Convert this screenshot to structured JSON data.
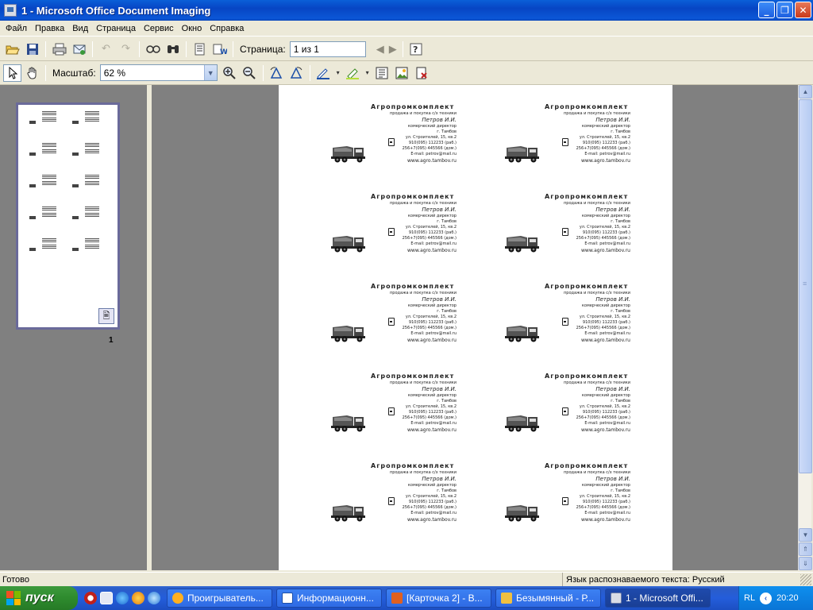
{
  "window": {
    "title": "1 - Microsoft Office Document Imaging",
    "minimize": "_",
    "maximize": "❐",
    "close": "✕"
  },
  "menu": [
    "Файл",
    "Правка",
    "Вид",
    "Страница",
    "Сервис",
    "Окно",
    "Справка"
  ],
  "toolbar": {
    "page_label": "Страница:",
    "page_value": "1 из 1",
    "zoom_label": "Масштаб:",
    "zoom_value": "62 %"
  },
  "thumbnails": [
    {
      "page_number": "1"
    }
  ],
  "cards": [
    {
      "company": "Агропромкомплект",
      "subtitle": "продажа и покупка с/х техники",
      "name": "Петров И.И.",
      "position": "комерческий директор",
      "city": "г. Тамбов",
      "address": "ул. Строителей, 15, кв.2",
      "phone1": "910(095) 112233 (раб.)",
      "phone2": "256+7(095) 445566 (дом.)",
      "email": "E-mail: petrov@mail.ru",
      "web": "www.agro.tambov.ru"
    }
  ],
  "status": {
    "left": "Готово",
    "right": "Язык распознаваемого текста: Русский"
  },
  "taskbar": {
    "start_label": "пуск",
    "tasks": [
      "Проигрыватель...",
      "Информационн...",
      "[Карточка 2] - В...",
      "Безымянный - Р...",
      "1 - Microsoft Offi..."
    ],
    "tray_lang": "RL",
    "clock": "20:20"
  }
}
